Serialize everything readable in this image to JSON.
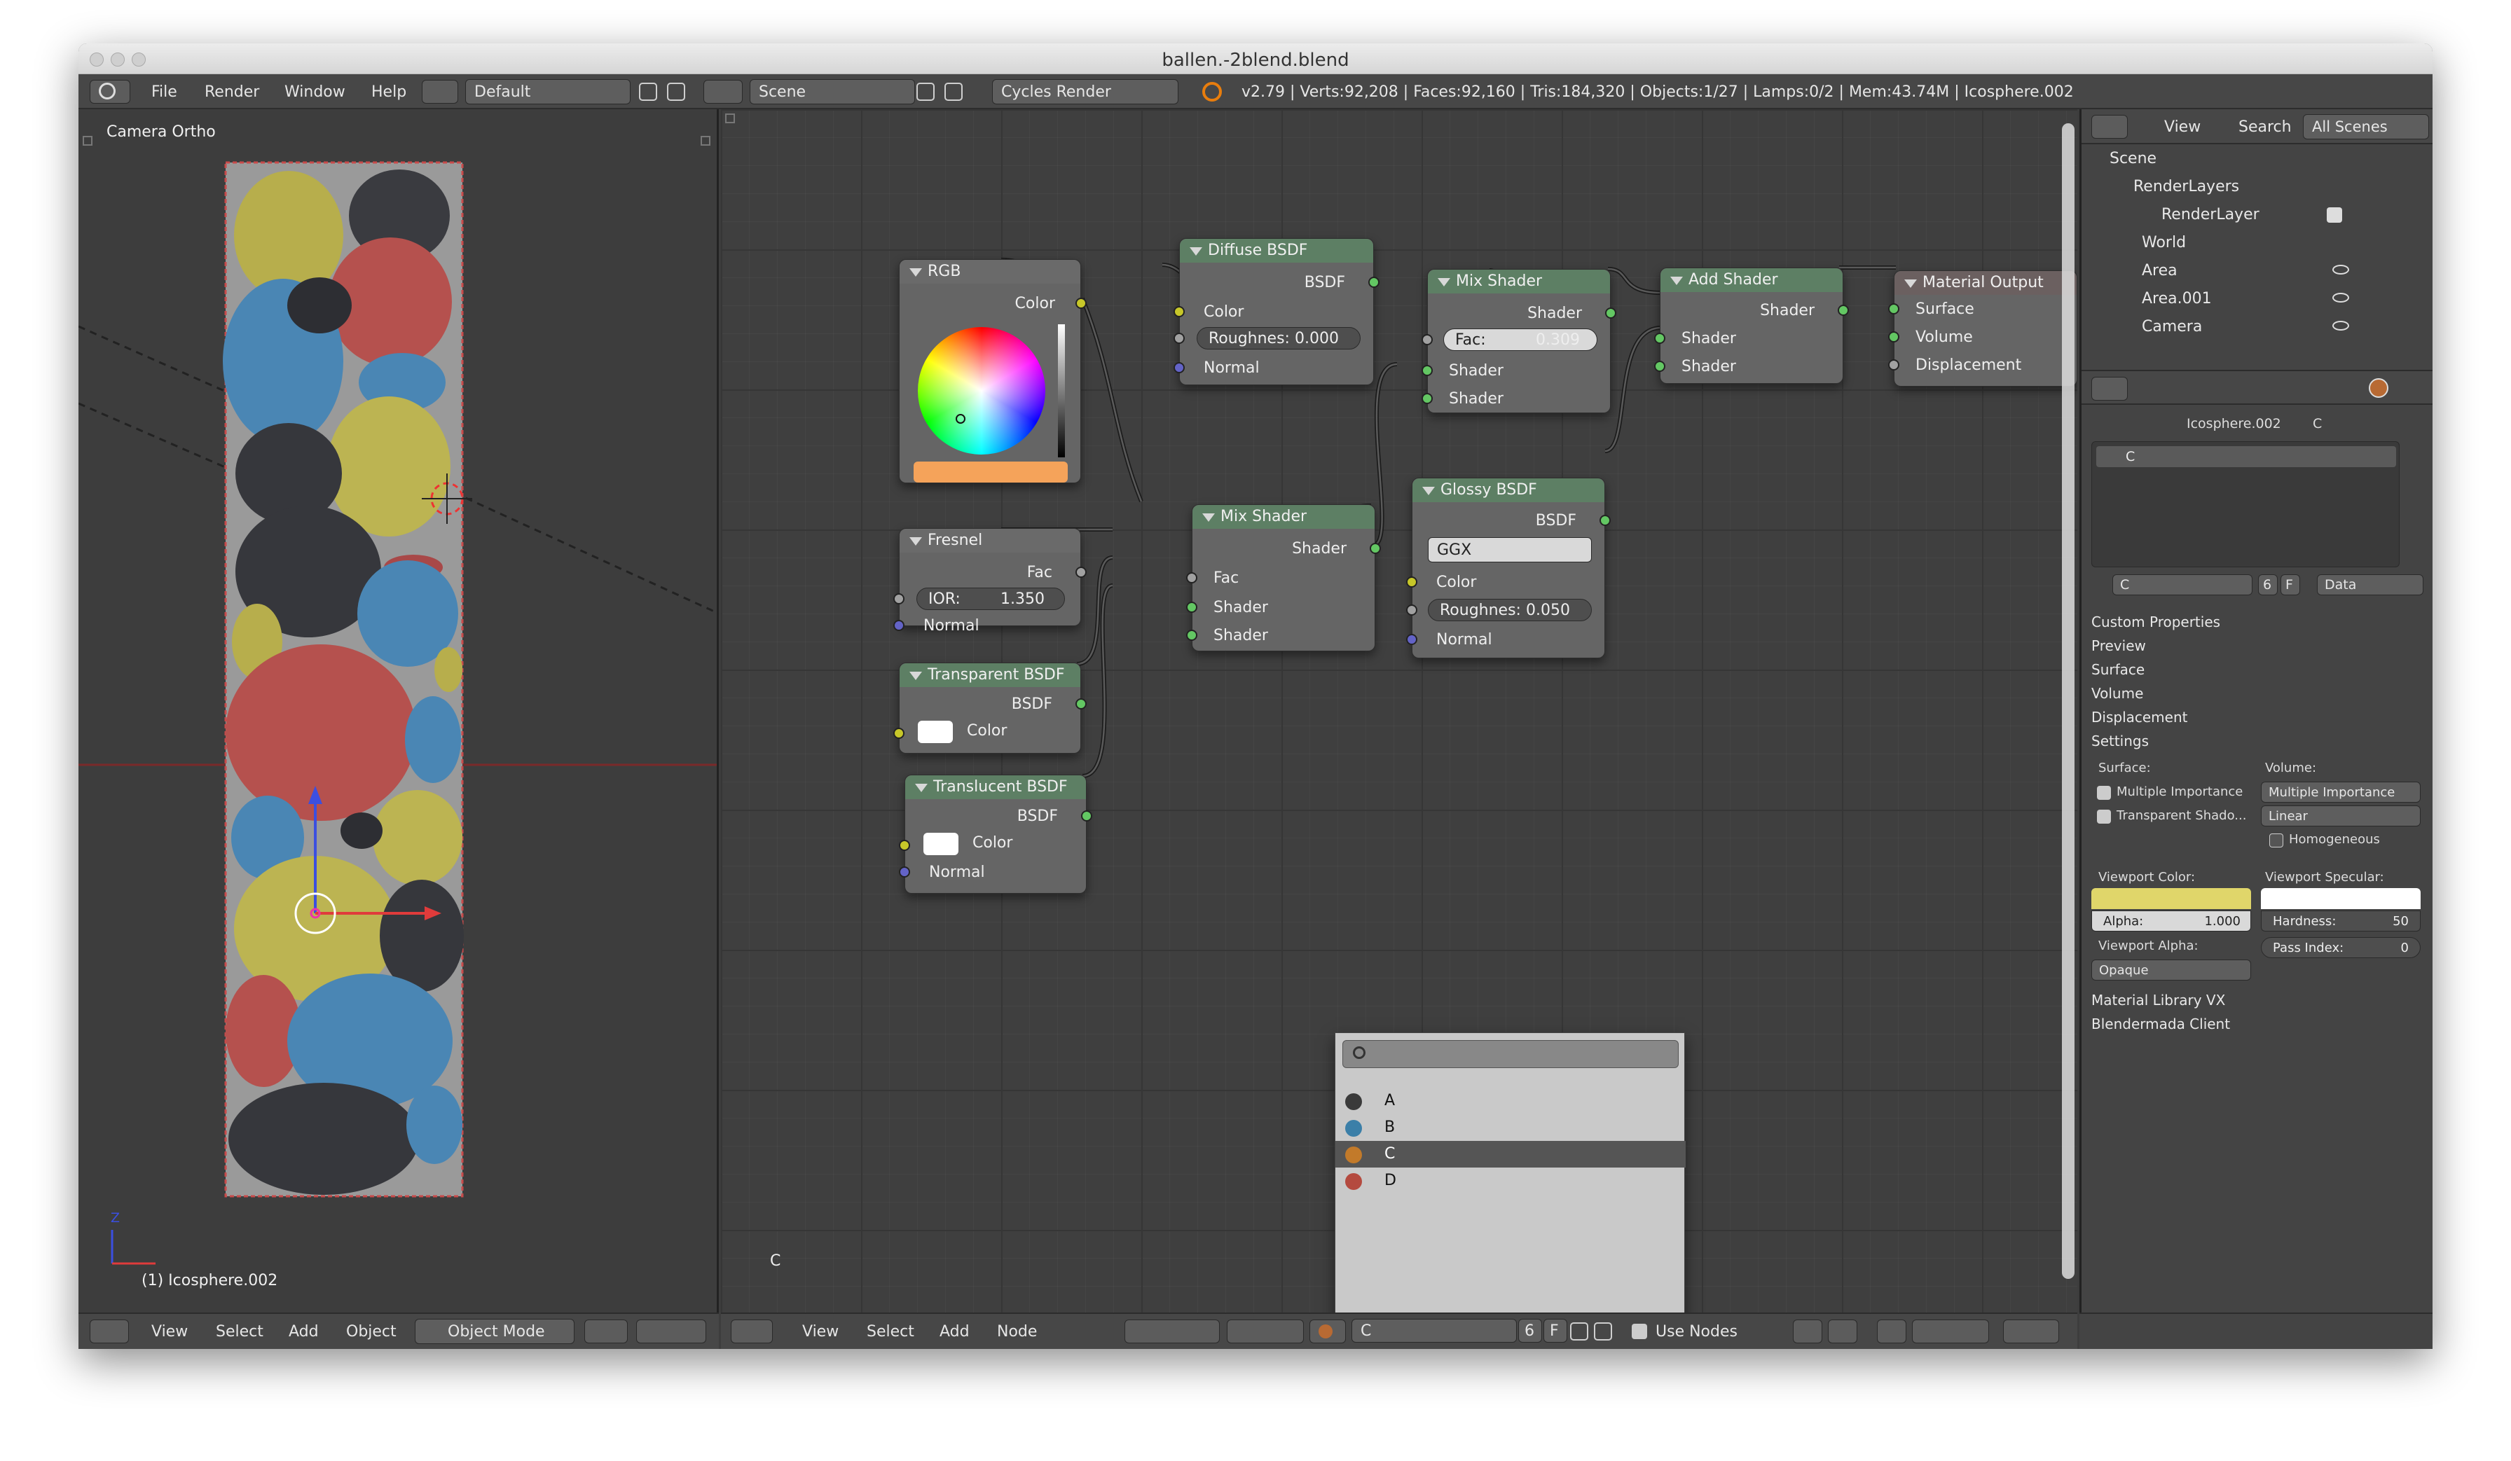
{
  "window": {
    "title": "ballen.-2blend.blend"
  },
  "infobar": {
    "menus": [
      "File",
      "Render",
      "Window",
      "Help"
    ],
    "layout": "Default",
    "scene": "Scene",
    "engine": "Cycles Render",
    "stats": "v2.79 | Verts:92,208 | Faces:92,160 | Tris:184,320 | Objects:1/27 | Lamps:0/2 | Mem:43.74M | Icosphere.002"
  },
  "viewport": {
    "label": "Camera Ortho",
    "object_label": "(1) Icosphere.002",
    "menus": [
      "View",
      "Select",
      "Add",
      "Object"
    ],
    "mode": "Object Mode",
    "axis_z": "Z"
  },
  "node_editor": {
    "material_label": "C",
    "menus": [
      "View",
      "Select",
      "Add",
      "Node"
    ],
    "material_field": "C",
    "users": "6",
    "fake": "F",
    "use_nodes": "Use Nodes",
    "nodes": {
      "rgb": {
        "title": "RGB",
        "out": "Color",
        "swatch": "#f5a35a"
      },
      "fresnel": {
        "title": "Fresnel",
        "out": "Fac",
        "ior_label": "IOR:",
        "ior": "1.350",
        "normal": "Normal"
      },
      "transparent": {
        "title": "Transparent BSDF",
        "out": "BSDF",
        "color": "Color"
      },
      "translucent": {
        "title": "Translucent BSDF",
        "out": "BSDF",
        "color": "Color",
        "normal": "Normal"
      },
      "diffuse": {
        "title": "Diffuse BSDF",
        "out": "BSDF",
        "color": "Color",
        "rough_label": "Roughnes:",
        "rough": "0.000",
        "normal": "Normal"
      },
      "mix1": {
        "title": "Mix Shader",
        "out": "Shader",
        "fac": "Fac",
        "in1": "Shader",
        "in2": "Shader"
      },
      "mix2": {
        "title": "Mix Shader",
        "out": "Shader",
        "fac_label": "Fac:",
        "fac": "0.309",
        "in1": "Shader",
        "in2": "Shader"
      },
      "glossy": {
        "title": "Glossy BSDF",
        "out": "BSDF",
        "dist": "GGX",
        "color": "Color",
        "rough_label": "Roughnes:",
        "rough": "0.050",
        "normal": "Normal"
      },
      "add": {
        "title": "Add Shader",
        "out": "Shader",
        "in1": "Shader",
        "in2": "Shader"
      },
      "output": {
        "title": "Material Output",
        "surface": "Surface",
        "volume": "Volume",
        "displacement": "Displacement"
      }
    },
    "popup": {
      "items": [
        {
          "name": "A",
          "color": "#3a3a3a"
        },
        {
          "name": "B",
          "color": "#3b7fa8"
        },
        {
          "name": "C",
          "color": "#c27a2a"
        },
        {
          "name": "D",
          "color": "#b44a3f"
        }
      ]
    }
  },
  "outliner": {
    "menus": [
      "View",
      "Search"
    ],
    "filter": "All Scenes",
    "items": [
      "Scene",
      "RenderLayers",
      "RenderLayer",
      "World",
      "Area",
      "Area.001",
      "Camera"
    ]
  },
  "properties": {
    "breadcrumb_obj": "Icosphere.002",
    "breadcrumb_mat": "C",
    "slot": "C",
    "mat_field": "C",
    "users": "6",
    "fake": "F",
    "link": "Data",
    "panels": [
      "Custom Properties",
      "Preview",
      "Surface",
      "Volume",
      "Displacement",
      "Settings"
    ],
    "settings": {
      "surface_label": "Surface:",
      "volume_label": "Volume:",
      "mult_imp": "Multiple Importance",
      "mult_imp_sel": "Multiple Importance",
      "trans_shadow": "Transparent Shado...",
      "linear": "Linear",
      "homogeneous": "Homogeneous",
      "viewport_color": "Viewport Color:",
      "viewport_specular": "Viewport Specular:",
      "alpha_label": "Alpha:",
      "alpha": "1.000",
      "hardness_label": "Hardness:",
      "hardness": "50",
      "viewport_alpha": "Viewport Alpha:",
      "pass_index_label": "Pass Index:",
      "pass_index": "0",
      "opaque": "Opaque",
      "color_swatch": "#e0d66a",
      "spec_swatch": "#ffffff"
    },
    "extra_panels": [
      "Material Library VX",
      "Blendermada Client"
    ]
  }
}
